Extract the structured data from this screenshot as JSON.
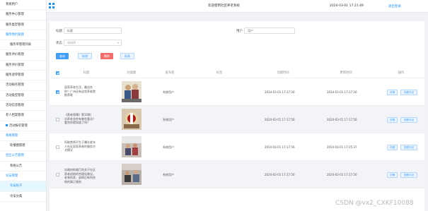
{
  "sidebar": {
    "items": [
      {
        "label": "系统用户",
        "style": "normal"
      },
      {
        "label": "服务中心管理",
        "style": "normal"
      },
      {
        "label": "服务类型管理",
        "style": "normal"
      },
      {
        "label": "服务预约管理",
        "style": "blue"
      },
      {
        "label": "服务单管理列表",
        "style": "sub"
      },
      {
        "label": "服务评价管理",
        "style": "normal"
      },
      {
        "label": "服务评价管理",
        "style": "normal"
      },
      {
        "label": "服务退单管理",
        "style": "normal"
      },
      {
        "label": "活动报名管理",
        "style": "normal"
      },
      {
        "label": "活动类型管理",
        "style": "normal"
      },
      {
        "label": "活动信息管理",
        "style": "normal"
      },
      {
        "label": "老人档案管理",
        "style": "normal"
      },
      {
        "label": "活动报名管理",
        "style": "dot"
      },
      {
        "label": "系统管理",
        "style": "blue"
      },
      {
        "label": "轮播图管理",
        "style": "sub"
      },
      {
        "label": "社区公告管理",
        "style": "blue"
      },
      {
        "label": "系统公告",
        "style": "sub"
      },
      {
        "label": "论坛管理",
        "style": "blue"
      },
      {
        "label": "论坛帖子",
        "style": "hl"
      },
      {
        "label": "论坛分类",
        "style": "sub"
      }
    ]
  },
  "header": {
    "title": "欢迎使用社区养老系统",
    "time": "2024-03-01 17:21:49",
    "logout": "退出登录"
  },
  "filters": {
    "title_label": "标题",
    "title_placeholder": "标题",
    "user_label": "用户",
    "user_placeholder": "用户",
    "status_label": "状态",
    "status_placeholder": "请选择"
  },
  "buttons": {
    "search": "查询",
    "add": "新增",
    "delete": "删除",
    "report": "报表"
  },
  "table": {
    "columns": [
      "标题",
      "封面图",
      "发布者",
      "标签",
      "创建时间",
      "更新时间",
      "操作"
    ],
    "rows": [
      {
        "checked": true,
        "title": "居家养老生活，最适合你！广州还有这些养老院推荐呢",
        "publisher": "系统用户",
        "tag": "",
        "created": "2024-03-01 17:17:56",
        "updated": "2024-03-01 17:17:56"
      },
      {
        "checked": false,
        "title": "《养老保障》第10期：对养老金你有哪些看法？看完你就知道了吗？",
        "publisher": "系统用户",
        "tag": "",
        "created": "2024-03-01 17:17:56",
        "updated": "2024-03-01 17:17:56"
      },
      {
        "checked": false,
        "title": "阿联酋将不生于曝光老年人社区居家养老的服务方式模式",
        "publisher": "系统用户",
        "tag": "",
        "created": "2024-03-01 17:17:56",
        "updated": "2024-03-01 17:25:37"
      },
      {
        "checked": false,
        "title": "向政府财政厅的关于社区养老机构的合理化建议。老有所养，退休后有所终结的真正服务",
        "publisher": "系统用户",
        "tag": "",
        "created": "2024-03-01 17:17:56",
        "updated": "2024-03-01 17:17:56"
      }
    ],
    "op_detail": "详情",
    "op_comment": "查看评论"
  },
  "watermark": "CSDN @vx2_CXKF10088",
  "colors": {
    "primary": "#409eff",
    "danger": "#f56c6c",
    "header_link": "#1890ff"
  }
}
